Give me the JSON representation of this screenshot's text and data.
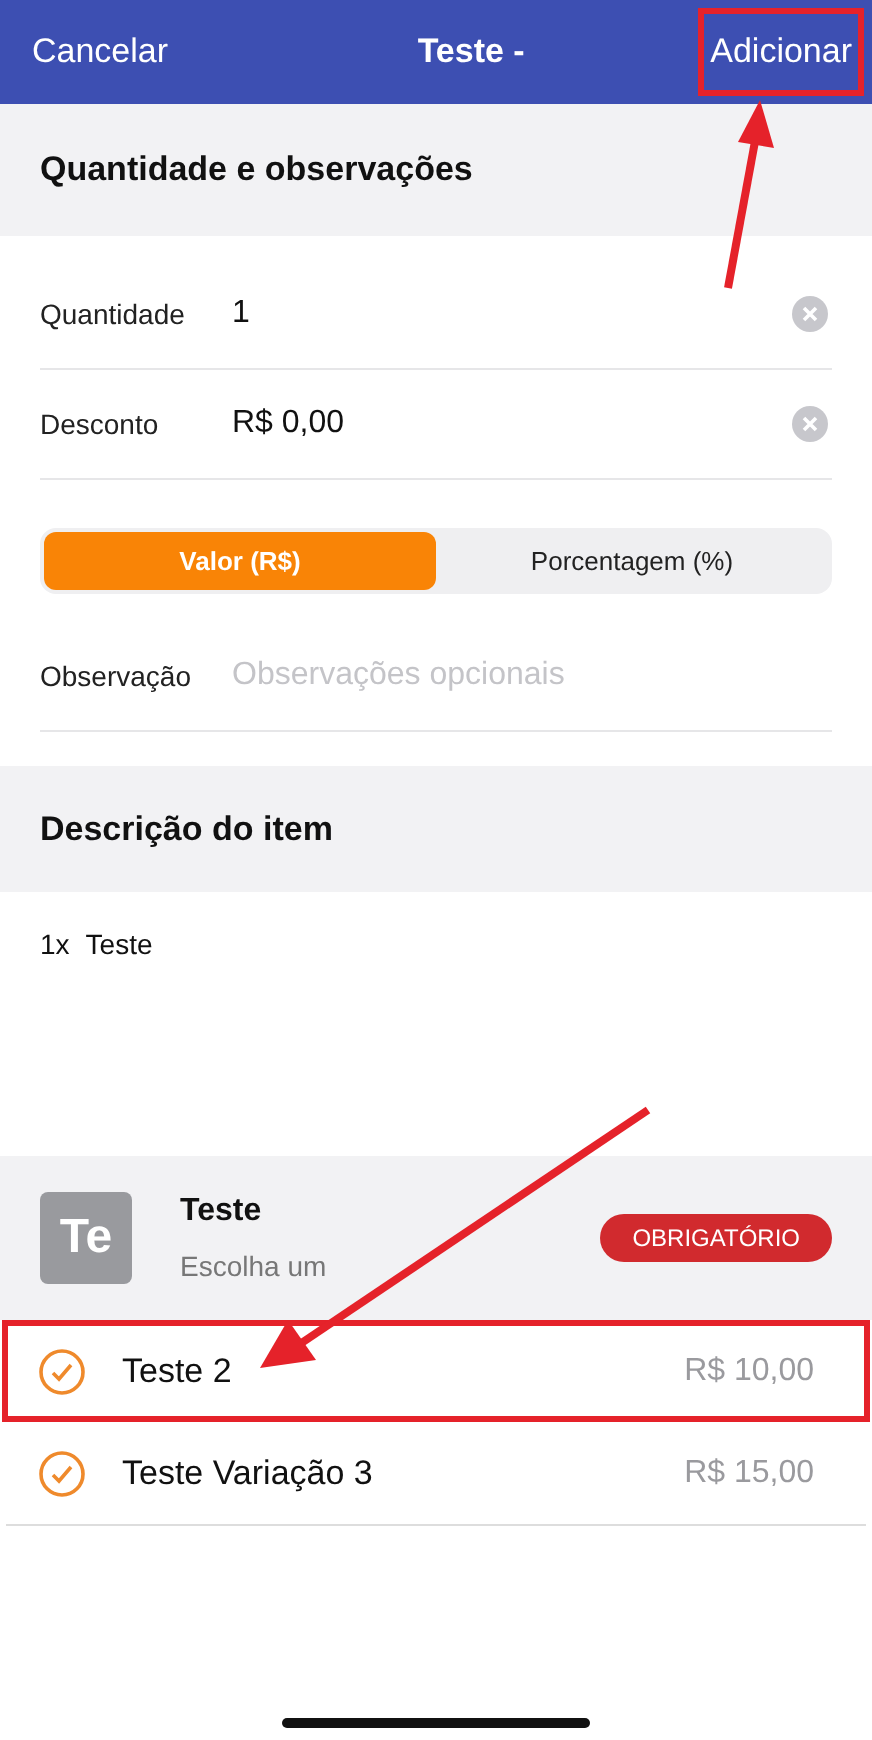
{
  "header": {
    "cancel": "Cancelar",
    "title": "Teste -",
    "action": "Adicionar",
    "action_highlighted": true
  },
  "quantity_section": {
    "title": "Quantidade e observações",
    "fields": [
      {
        "label": "Quantidade",
        "value": "1"
      },
      {
        "label": "Desconto",
        "value": "R$ 0,00"
      }
    ],
    "discount_type": [
      {
        "label": "Valor (R$)",
        "selected": true
      },
      {
        "label": "Porcentagem (%)",
        "selected": false
      }
    ],
    "note": {
      "label": "Observação",
      "placeholder": "Observações opcionais"
    }
  },
  "description_section": {
    "title": "Descrição do item",
    "quantity": "1x",
    "item": "Teste"
  },
  "group": {
    "thumb": "Te",
    "name": "Teste",
    "hint": "Escolha um",
    "badge": "OBRIGATÓRIO",
    "options": [
      {
        "name": "Teste 2",
        "price": "R$ 10,00",
        "highlighted": true
      },
      {
        "name": "Teste Variação 3",
        "price": "R$ 15,00",
        "highlighted": false
      }
    ]
  }
}
